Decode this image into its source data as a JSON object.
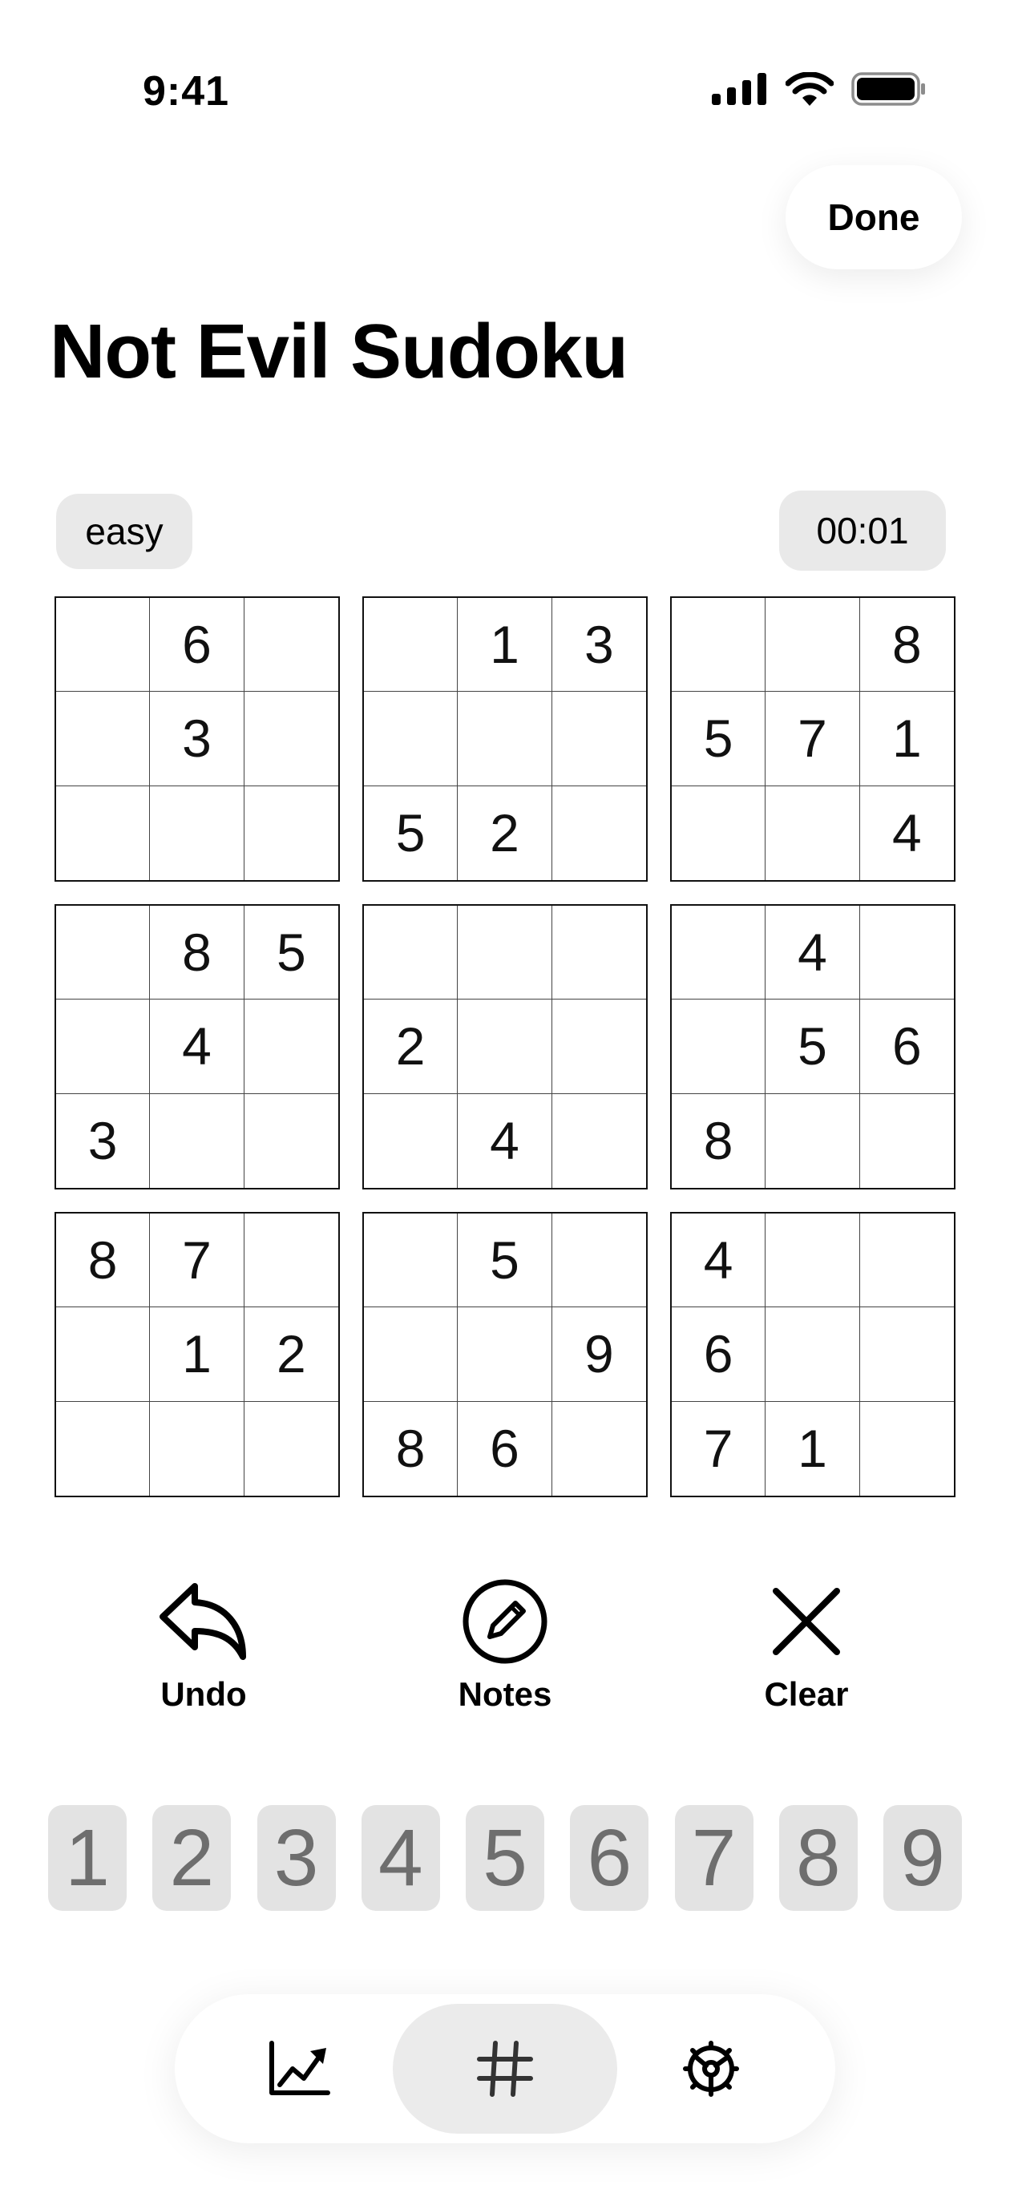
{
  "status_bar": {
    "time": "9:41",
    "icons": [
      "signal-icon",
      "wifi-icon",
      "battery-icon"
    ]
  },
  "header": {
    "done_label": "Done",
    "title": "Not Evil Sudoku"
  },
  "game": {
    "difficulty": "easy",
    "timer": "00:01"
  },
  "board": {
    "boxes": [
      [
        "",
        "6",
        "",
        "",
        "3",
        "",
        "",
        "",
        ""
      ],
      [
        "",
        "1",
        "3",
        "",
        "",
        "",
        "5",
        "2",
        ""
      ],
      [
        "",
        "",
        "8",
        "5",
        "7",
        "1",
        "",
        "",
        "4"
      ],
      [
        "",
        "8",
        "5",
        "",
        "4",
        "",
        "3",
        "",
        ""
      ],
      [
        "",
        "",
        "",
        "2",
        "",
        "",
        "",
        "4",
        ""
      ],
      [
        "",
        "4",
        "",
        "",
        "5",
        "6",
        "8",
        "",
        ""
      ],
      [
        "8",
        "7",
        "",
        "",
        "1",
        "2",
        "",
        "",
        ""
      ],
      [
        "",
        "5",
        "",
        "",
        "",
        "9",
        "8",
        "6",
        ""
      ],
      [
        "4",
        "",
        "",
        "6",
        "",
        "",
        "7",
        "1",
        ""
      ]
    ]
  },
  "tools": {
    "undo_label": "Undo",
    "notes_label": "Notes",
    "clear_label": "Clear"
  },
  "numpad": [
    "1",
    "2",
    "3",
    "4",
    "5",
    "6",
    "7",
    "8",
    "9"
  ],
  "tab_bar": {
    "tabs": [
      "stats-icon",
      "grid-hash-icon",
      "settings-gear-icon"
    ],
    "active": "grid-hash-icon"
  },
  "colors": {
    "pill_bg": "#e9e9e9",
    "numpad_bg": "#e3e3e3",
    "numpad_text": "#6e6e6e"
  }
}
